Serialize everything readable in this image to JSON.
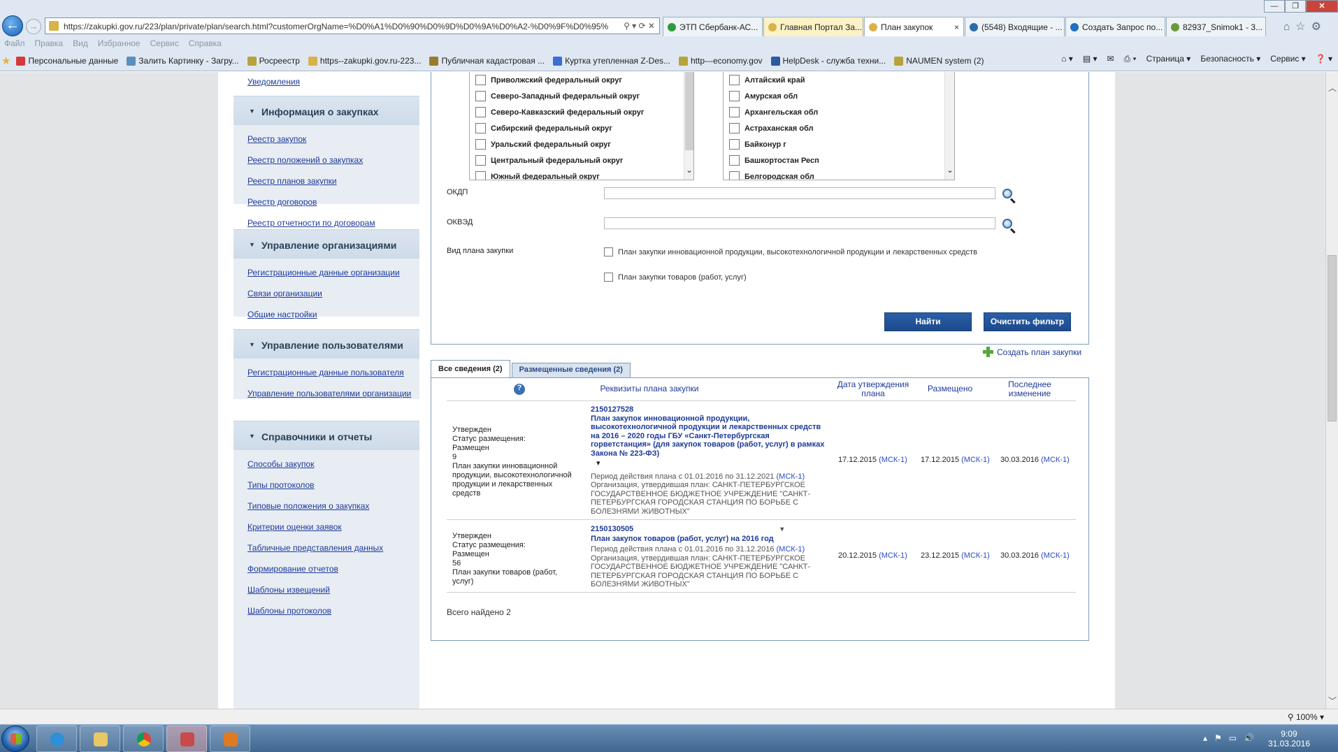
{
  "browser": {
    "url": "https://zakupki.gov.ru/223/plan/private/plan/search.html?customerOrgName=%D0%A1%D0%90%D0%9D%D0%9A%D0%A2-%D0%9F%D0%95%D0",
    "tabs": [
      {
        "label": "ЭТП Сбербанк-АС...",
        "icon_color": "#2e9c3a",
        "state": "normal"
      },
      {
        "label": "Главная Портал За...",
        "icon_color": "#d9b24a",
        "state": "highlight"
      },
      {
        "label": "План закупок",
        "icon_color": "#d9b24a",
        "state": "active"
      },
      {
        "label": "(5548) Входящие - ...",
        "icon_color": "#2d6aa8",
        "state": "normal"
      },
      {
        "label": "Создать Запрос по...",
        "icon_color": "#1f6fc2",
        "state": "normal"
      },
      {
        "label": "82937_Snimok1 - 3...",
        "icon_color": "#6a9a3a",
        "state": "normal"
      }
    ],
    "menu": [
      "Файл",
      "Правка",
      "Вид",
      "Избранное",
      "Сервис",
      "Справка"
    ],
    "favorites": [
      {
        "label": "Персональные данные",
        "icon_color": "#d23b3b"
      },
      {
        "label": "Залить Картинку - Загру...",
        "icon_color": "#5a8fbf"
      },
      {
        "label": "Росреестр",
        "icon_color": "#b8a23c"
      },
      {
        "label": "https--zakupki.gov.ru-223...",
        "icon_color": "#d9b24a"
      },
      {
        "label": "Публичная кадастровая ...",
        "icon_color": "#9a7b2c"
      },
      {
        "label": "Куртка утепленная Z-Des...",
        "icon_color": "#3a6fd8"
      },
      {
        "label": "http---economy.gov",
        "icon_color": "#b8a23c"
      },
      {
        "label": "HelpDesk - служба техни...",
        "icon_color": "#2d5aa0"
      },
      {
        "label": "NAUMEN system (2)",
        "icon_color": "#b8a23c"
      }
    ],
    "tools": [
      "Страница ▾",
      "Безопасность ▾",
      "Сервис ▾"
    ],
    "zoom": "100%"
  },
  "sidebar": {
    "top_link": "Уведомления",
    "blocks": [
      {
        "title": "Информация о закупках",
        "links": [
          "Реестр закупок",
          "Реестр положений о закупках",
          "Реестр планов закупки",
          "Реестр договоров",
          "Реестр отчетности по договорам"
        ]
      },
      {
        "title": "Управление организациями",
        "links": [
          "Регистрационные данные организации",
          "Связи организации",
          "Общие настройки"
        ]
      },
      {
        "title": "Управление пользователями",
        "links": [
          "Регистрационные данные пользователя",
          "Управление пользователями организации"
        ]
      },
      {
        "title": "Справочники и отчеты",
        "links": [
          "Способы закупок",
          "Типы протоколов",
          "Типовые положения о закупках",
          "Критерии оценки заявок",
          "Табличные представления данных",
          "Формирование отчетов",
          "Шаблоны извещений",
          "Шаблоны протоколов"
        ]
      }
    ]
  },
  "filter": {
    "districts": [
      "Приволжский федеральный округ",
      "Северо-Западный федеральный округ",
      "Северо-Кавказский федеральный округ",
      "Сибирский федеральный округ",
      "Уральский федеральный округ",
      "Центральный федеральный округ",
      "Южный федеральный округ"
    ],
    "regions": [
      "Алтайский край",
      "Амурская обл",
      "Архангельская обл",
      "Астраханская обл",
      "Байконур г",
      "Башкортостан Респ",
      "Белгородская обл"
    ],
    "okdp_label": "ОКДП",
    "okved_label": "ОКВЭД",
    "plan_type_label": "Вид плана закупки",
    "plan_type_options": [
      "План закупки инновационной продукции, высокотехнологичной продукции и лекарственных средств",
      "План закупки товаров (работ, услуг)"
    ],
    "find_button": "Найти",
    "clear_button": "Очистить фильтр"
  },
  "create_plan": "Создать план закупки",
  "result_tabs": [
    "Все сведения (2)",
    "Размещенные сведения (2)"
  ],
  "table": {
    "headers": {
      "help": "?",
      "details": "Реквизиты плана закупки",
      "approval_date": "Дата утверждения плана",
      "placed": "Размещено",
      "last_change": "Последнее изменение"
    },
    "rows": [
      {
        "status": [
          "Утвержден",
          "Статус размещения:",
          "Размещен",
          "9",
          "План закупки инновационной продукции, высокотехнологичной продукции и лекарственных средств"
        ],
        "number": "2150127528",
        "title": "План закупок инновационной продукции, высокотехнологичной продукции и лекарственных средств на 2016 – 2020 годы ГБУ «Санкт-Петербургская горветстанция» (для закупок товаров (работ, услуг) в рамках Закона № 223-ФЗ)",
        "period": "Период действия плана с 01.01.2016 по 31.12.2021",
        "org": "Организация, утвердившая план:  САНКТ-ПЕТЕРБУРГСКОЕ ГОСУДАРСТВЕННОЕ БЮДЖЕТНОЕ УЧРЕЖДЕНИЕ \"САНКТ-ПЕТЕРБУРГСКАЯ ГОРОДСКАЯ СТАНЦИЯ ПО БОРЬБЕ С БОЛЕЗНЯМИ ЖИВОТНЫХ\"",
        "approval_date": "17.12.2015",
        "placed": "17.12.2015",
        "last_change": "30.03.2016",
        "tz": "(МСК-1)"
      },
      {
        "status": [
          "Утвержден",
          "Статус размещения:",
          "Размещен",
          "56",
          "План закупки товаров (работ, услуг)"
        ],
        "number": "2150130505",
        "title": "План закупок товаров (работ, услуг) на 2016 год",
        "period": "Период действия плана с 01.01.2016 по 31.12.2016",
        "org": "Организация, утвердившая план:  САНКТ-ПЕТЕРБУРГСКОЕ ГОСУДАРСТВЕННОЕ БЮДЖЕТНОЕ УЧРЕЖДЕНИЕ \"САНКТ-ПЕТЕРБУРГСКАЯ ГОРОДСКАЯ СТАНЦИЯ ПО БОРЬБЕ С БОЛЕЗНЯМИ ЖИВОТНЫХ\"",
        "approval_date": "20.12.2015",
        "placed": "23.12.2015",
        "last_change": "30.03.2016",
        "tz": "(МСК-1)"
      }
    ],
    "total": "Всего найдено 2"
  },
  "taskbar": {
    "time": "9:09",
    "date": "31.03.2016"
  }
}
